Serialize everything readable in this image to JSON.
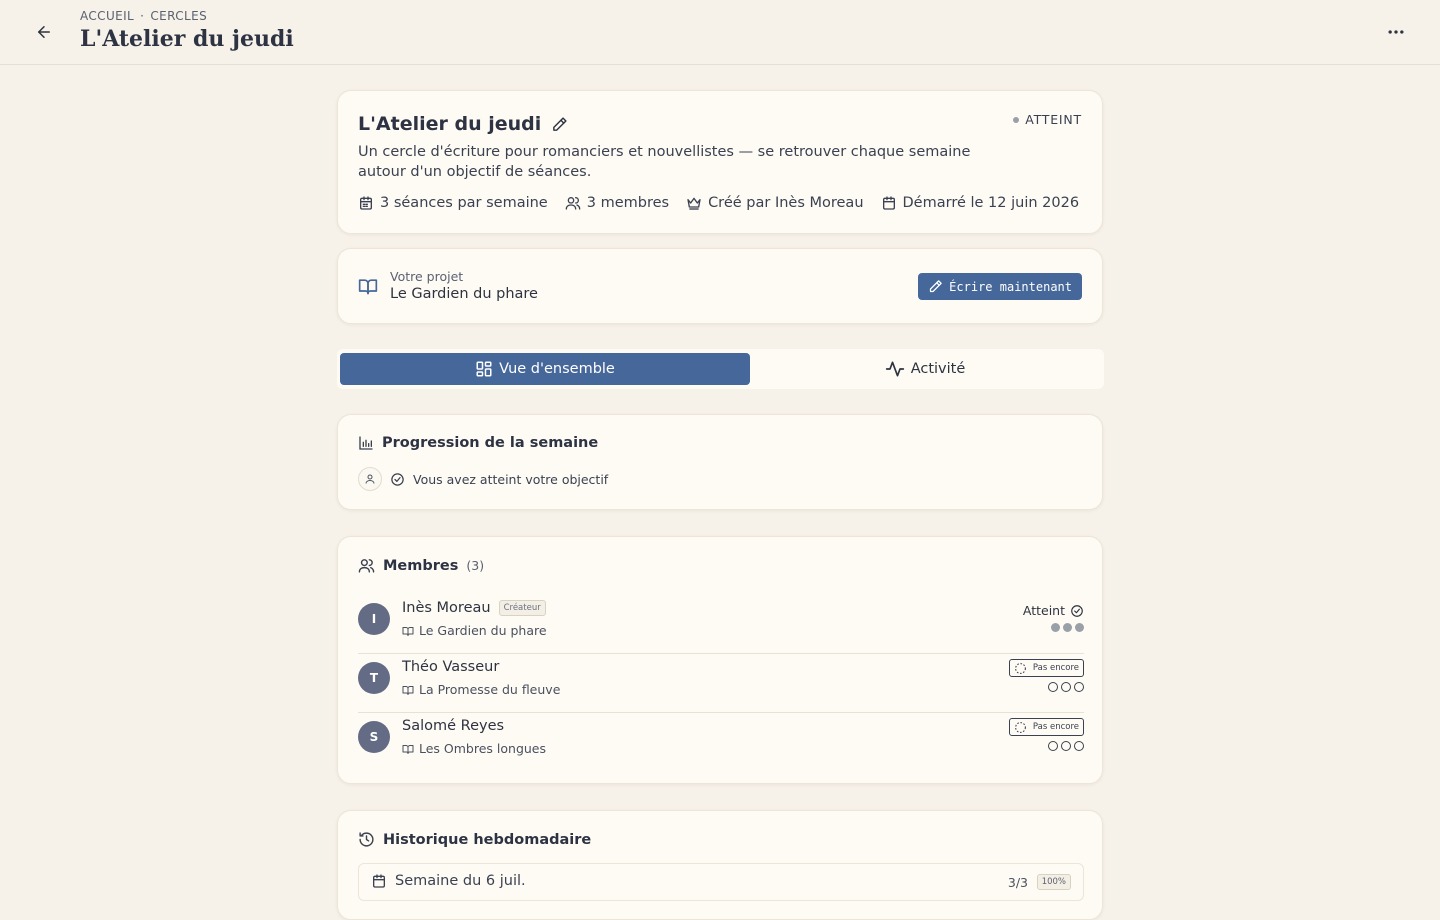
{
  "header": {
    "breadcrumb": [
      "ACCUEIL",
      "CERCLES"
    ],
    "breadcrumb_sep": "·",
    "title": "L'Atelier du jeudi"
  },
  "circle": {
    "title": "L'Atelier du jeudi",
    "status": "ATTEINT",
    "description": "Un cercle d'écriture pour romanciers et nouvellistes — se retrouver chaque semaine autour d'un objectif de séances.",
    "meta": {
      "sessions": "3 séances par semaine",
      "members": "3 membres",
      "creator": "Créé par Inès Moreau",
      "started": "Démarré le 12 juin 2026"
    }
  },
  "project": {
    "label": "Votre projet",
    "name": "Le Gardien du phare",
    "write_button": "Écrire maintenant"
  },
  "tabs": {
    "overview": "Vue d'ensemble",
    "activity": "Activité"
  },
  "progress": {
    "title": "Progression de la semaine",
    "message": "Vous avez atteint votre objectif"
  },
  "members": {
    "title": "Membres",
    "count": "(3)",
    "list": [
      {
        "initial": "I",
        "name": "Inès Moreau",
        "badge": "Créateur",
        "book": "Le Gardien du phare",
        "status": "Atteint",
        "done": 3,
        "goal": 3
      },
      {
        "initial": "T",
        "name": "Théo Vasseur",
        "badge": "",
        "book": "La Promesse du fleuve",
        "status": "Pas encore",
        "done": 0,
        "goal": 3
      },
      {
        "initial": "S",
        "name": "Salomé Reyes",
        "badge": "",
        "book": "Les Ombres longues",
        "status": "Pas encore",
        "done": 0,
        "goal": 3
      }
    ]
  },
  "history": {
    "title": "Historique hebdomadaire",
    "weeks": [
      {
        "label": "Semaine du 6 juil.",
        "score": "3/3",
        "percent": "100%"
      }
    ]
  },
  "colors": {
    "primary": "#46679a",
    "background": "#f6f1e9",
    "card": "#fefbf5",
    "avatar": "#646c85"
  }
}
